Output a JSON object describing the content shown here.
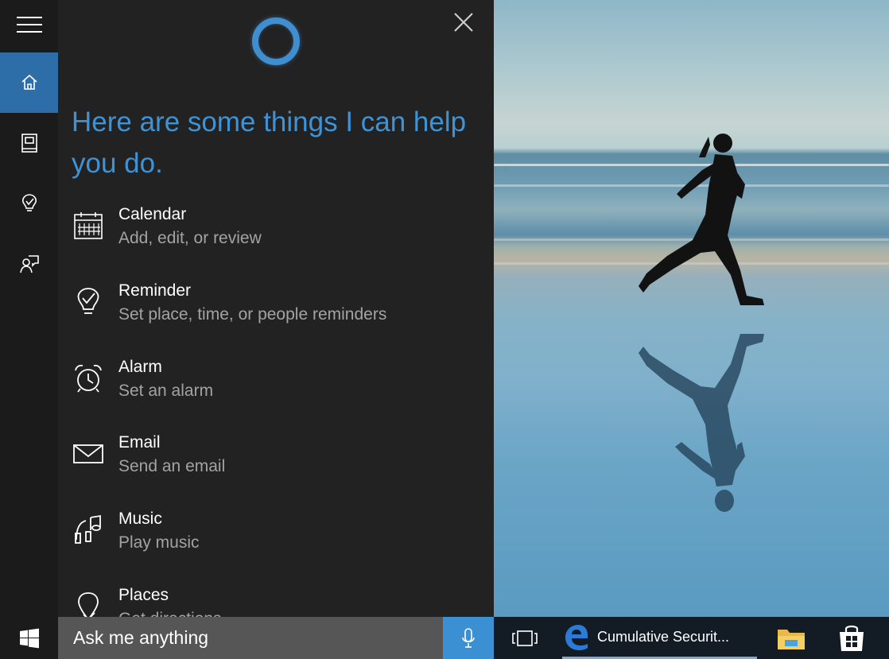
{
  "cortana": {
    "heading": "Here are some things I can help you do.",
    "suggestions": [
      {
        "title": "Calendar",
        "subtitle": "Add, edit, or review",
        "icon": "calendar-icon"
      },
      {
        "title": "Reminder",
        "subtitle": "Set place, time, or people reminders",
        "icon": "reminder-icon"
      },
      {
        "title": "Alarm",
        "subtitle": "Set an alarm",
        "icon": "alarm-clock-icon"
      },
      {
        "title": "Email",
        "subtitle": "Send an email",
        "icon": "envelope-icon"
      },
      {
        "title": "Music",
        "subtitle": "Play music",
        "icon": "music-icon"
      },
      {
        "title": "Places",
        "subtitle": "Get directions",
        "icon": "map-pin-icon"
      }
    ]
  },
  "nav": {
    "items": [
      {
        "name": "hamburger-menu",
        "icon": "hamburger-icon"
      },
      {
        "name": "home",
        "icon": "home-icon",
        "active": true
      },
      {
        "name": "notebook",
        "icon": "notebook-icon"
      },
      {
        "name": "reminders",
        "icon": "lightbulb-icon"
      },
      {
        "name": "feedback",
        "icon": "feedback-icon"
      }
    ]
  },
  "taskbar": {
    "search_placeholder": "Ask me anything",
    "edge_task_label": "Cumulative Securit...",
    "icons": [
      "windows-start-icon",
      "microphone-icon",
      "task-view-icon",
      "edge-icon",
      "file-explorer-icon",
      "store-icon"
    ]
  },
  "colors": {
    "accent": "#3d93d6",
    "nav_active": "#2d6ea8",
    "panel_bg": "#222222",
    "taskbar_bg": "#131c24",
    "search_bg": "#565656",
    "mic_bg": "#3b8fd3"
  }
}
